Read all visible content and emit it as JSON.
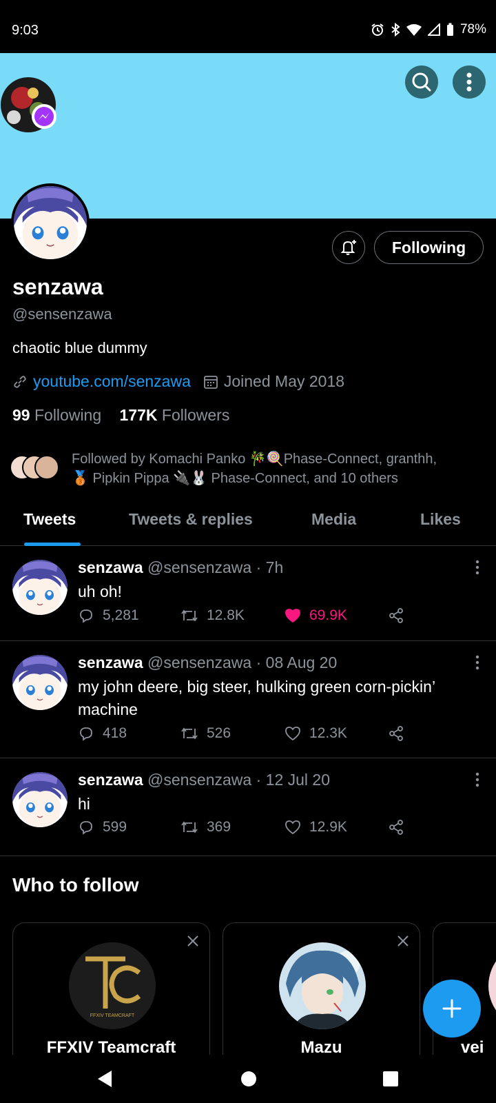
{
  "status_bar": {
    "time": "9:03",
    "battery": "78%"
  },
  "profile": {
    "display_name": "senzawa",
    "handle": "@sensenzawa",
    "bio": "chaotic blue dummy",
    "link": "youtube.com/senzawa",
    "joined": "Joined May 2018",
    "following_count": "99",
    "following_label": "Following",
    "followers_count": "177K",
    "followers_label": "Followers",
    "follow_button": "Following",
    "followed_by_line1": "Followed by Komachi Panko 🎋🍭Phase-Connect, granthh,",
    "followed_by_line2": "🥉 Pipkin Pippa 🔌🐰 Phase-Connect, and 10 others"
  },
  "tabs": [
    "Tweets",
    "Tweets & replies",
    "Media",
    "Likes"
  ],
  "tweets": [
    {
      "name": "senzawa",
      "meta": "@sensenzawa · 7h",
      "text": "uh oh!",
      "replies": "5,281",
      "retweets": "12.8K",
      "likes": "69.9K",
      "liked": true
    },
    {
      "name": "senzawa",
      "meta": "@sensenzawa · 08 Aug 20",
      "text": "my john deere, big steer, hulking green corn-pickin’ machine",
      "replies": "418",
      "retweets": "526",
      "likes": "12.3K",
      "liked": false
    },
    {
      "name": "senzawa",
      "meta": "@sensenzawa · 12 Jul 20",
      "text": "hi",
      "replies": "599",
      "retweets": "369",
      "likes": "12.9K",
      "liked": false
    }
  ],
  "who_to_follow": {
    "title": "Who to follow",
    "cards": [
      "FFXIV Teamcraft",
      "Mazu",
      "vei"
    ],
    "logo_text": "FFXIV TEAMCRAFT"
  },
  "colors": {
    "banner": "#79dbf7",
    "accent": "#1d9bf0",
    "like": "#f91880"
  },
  "icons": [
    "search-icon",
    "more-icon",
    "bell-icon",
    "link-icon",
    "calendar-icon",
    "reply-icon",
    "retweet-icon",
    "heart-icon",
    "share-icon",
    "close-icon",
    "plus-icon"
  ]
}
